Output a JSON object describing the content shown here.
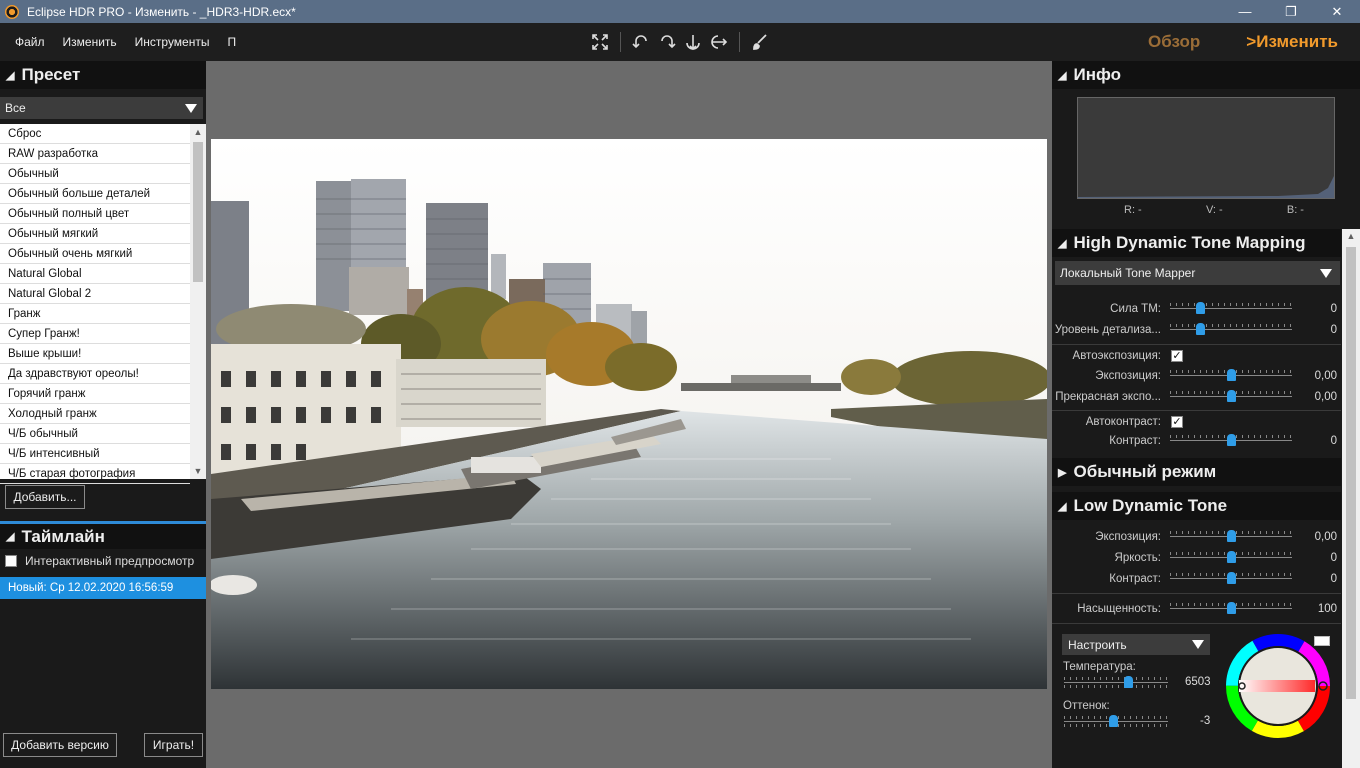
{
  "window": {
    "title": "Eclipse HDR PRO - Изменить - _HDR3-HDR.ecx*"
  },
  "menu": [
    "Файл",
    "Изменить",
    "Инструменты",
    "П"
  ],
  "modes": {
    "overview": "Обзор",
    "edit": ">Изменить"
  },
  "preset": {
    "title": "Пресет",
    "filter": "Все",
    "items": [
      "Сброс",
      "RAW разработка",
      "Обычный",
      "Обычный больше деталей",
      "Обычный полный цвет",
      "Обычный мягкий",
      "Обычный очень мягкий",
      "Natural Global",
      "Natural Global 2",
      "Гранж",
      "Супер Гранж!",
      "Выше крыши!",
      "Да здравствуют ореолы!",
      "Горячий гранж",
      "Холодный гранж",
      "Ч/Б обычный",
      "Ч/Б интенсивный",
      "Ч/Б старая фотография"
    ],
    "add_button": "Добавить..."
  },
  "timeline": {
    "title": "Таймлайн",
    "interactive_preview": "Интерактивный предпросмотр",
    "version_entry": "Новый: Ср 12.02.2020 16:56:59",
    "add_version_button": "Добавить версию",
    "play_button": "Играть!"
  },
  "info": {
    "title": "Инфо",
    "r": "R: -",
    "v": "V: -",
    "b": "B: -"
  },
  "hdr": {
    "title": "High Dynamic Tone Mapping",
    "mapper": "Локальный Tone Mapper",
    "strength": {
      "label": "Сила ТМ:",
      "value": "0",
      "level": 0.25
    },
    "detail": {
      "label": "Уровень детализа...",
      "value": "0",
      "level": 0.25
    },
    "autoexposure": {
      "label": "Автоэкспозиция:",
      "checked": true
    },
    "exposure": {
      "label": "Экспозиция:",
      "value": "0,00",
      "level": 0.5
    },
    "fine_exposure": {
      "label": "Прекрасная экспо...",
      "value": "0,00",
      "level": 0.5
    },
    "autocontrast": {
      "label": "Автоконтраст:",
      "checked": true
    },
    "contrast": {
      "label": "Контраст:",
      "value": "0",
      "level": 0.5
    }
  },
  "normal_mode": {
    "title": "Обычный режим"
  },
  "ldr": {
    "title": "Low Dynamic Tone",
    "exposure": {
      "label": "Экспозиция:",
      "value": "0,00",
      "level": 0.5
    },
    "brightness": {
      "label": "Яркость:",
      "value": "0",
      "level": 0.5
    },
    "contrast": {
      "label": "Контраст:",
      "value": "0",
      "level": 0.5
    },
    "saturation": {
      "label": "Насыщенность:",
      "value": "100",
      "level": 0.5
    },
    "wb_mode": "Настроить",
    "temperature": {
      "label": "Температура:",
      "value": "6503",
      "level": 0.62
    },
    "tint": {
      "label": "Оттенок:",
      "value": "-3",
      "level": 0.48
    }
  },
  "colors": {
    "accent": "#f19a2c",
    "selection": "#1e90e0",
    "knob": "#2f9de8"
  }
}
